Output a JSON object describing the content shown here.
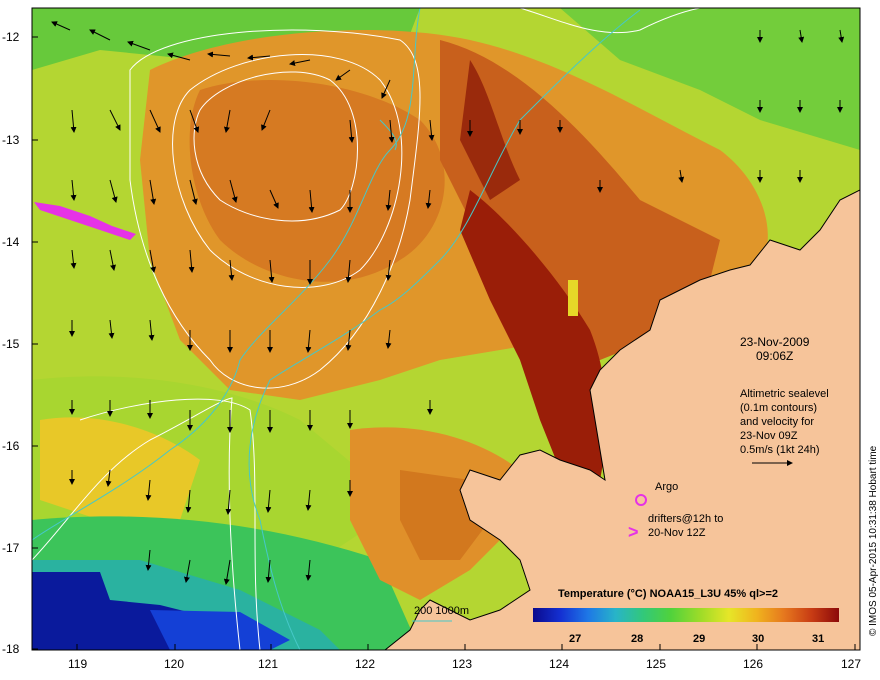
{
  "map": {
    "y_ticks": [
      "-12",
      "-13",
      "-14",
      "-15",
      "-16",
      "-17",
      "-18"
    ],
    "x_ticks": [
      "119",
      "120",
      "121",
      "122",
      "123",
      "124",
      "125",
      "126",
      "127"
    ],
    "date": "23-Nov-2009",
    "time": "09:06Z",
    "altimetry_note": [
      "Altimetric sealevel",
      "(0.1m contours)",
      "and velocity for",
      "23-Nov 09Z",
      "0.5m/s (1kt 24h)"
    ],
    "argo_label": "Argo",
    "drifters_label": [
      "drifters@12h to",
      "20-Nov 12Z"
    ],
    "drifter_glyph": ">",
    "isobath_label": "200  1000m",
    "credit": "© IMOS 05-Apr-2015 10:31:38 Hobart time",
    "colorbar": {
      "title": "Temperature (°C) NOAA15_L3U 45% ql>=2",
      "ticks": [
        "27",
        "28",
        "29",
        "30",
        "31"
      ],
      "colors": [
        "#0a0a8c",
        "#1430d2",
        "#1e78e6",
        "#28b4c8",
        "#32c87a",
        "#50d23c",
        "#a0dc28",
        "#e6e628",
        "#f0b41e",
        "#e6781e",
        "#c83c14",
        "#8c0a0a"
      ]
    },
    "colors": {
      "land": "#f6c49a",
      "warm": "#d2781e",
      "hot": "#9a1e08",
      "contour": "#ffffff",
      "isobath": "#46c8c8",
      "drifter": "#e632e6"
    }
  }
}
